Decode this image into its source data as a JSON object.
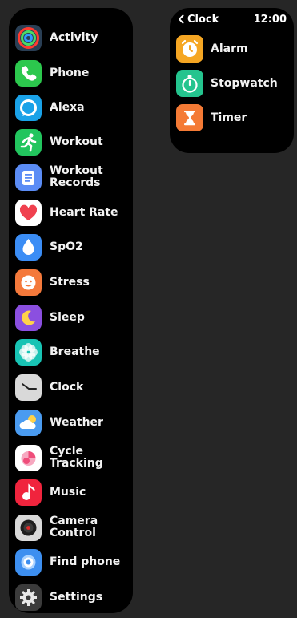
{
  "app_list": {
    "items": [
      {
        "label": "Activity",
        "icon": "activity-rings-icon"
      },
      {
        "label": "Phone",
        "icon": "phone-icon"
      },
      {
        "label": "Alexa",
        "icon": "alexa-icon"
      },
      {
        "label": "Workout",
        "icon": "running-figure-icon"
      },
      {
        "label": "Workout Records",
        "icon": "records-document-icon"
      },
      {
        "label": "Heart Rate",
        "icon": "heart-icon"
      },
      {
        "label": "SpO2",
        "icon": "blood-drop-icon"
      },
      {
        "label": "Stress",
        "icon": "stress-face-icon"
      },
      {
        "label": "Sleep",
        "icon": "moon-icon"
      },
      {
        "label": "Breathe",
        "icon": "flower-icon"
      },
      {
        "label": "Clock",
        "icon": "clock-icon"
      },
      {
        "label": "Weather",
        "icon": "cloud-sun-icon"
      },
      {
        "label": "Cycle Tracking",
        "icon": "cycle-tracking-icon"
      },
      {
        "label": "Music",
        "icon": "music-note-icon"
      },
      {
        "label": "Camera Control",
        "icon": "camera-lens-icon"
      },
      {
        "label": "Find phone",
        "icon": "find-phone-icon"
      },
      {
        "label": "Settings",
        "icon": "gear-icon"
      }
    ]
  },
  "clock_screen": {
    "back_label": "Clock",
    "time": "12:00",
    "items": [
      {
        "label": "Alarm",
        "icon": "alarm-clock-icon"
      },
      {
        "label": "Stopwatch",
        "icon": "stopwatch-icon"
      },
      {
        "label": "Timer",
        "icon": "hourglass-icon"
      }
    ]
  }
}
